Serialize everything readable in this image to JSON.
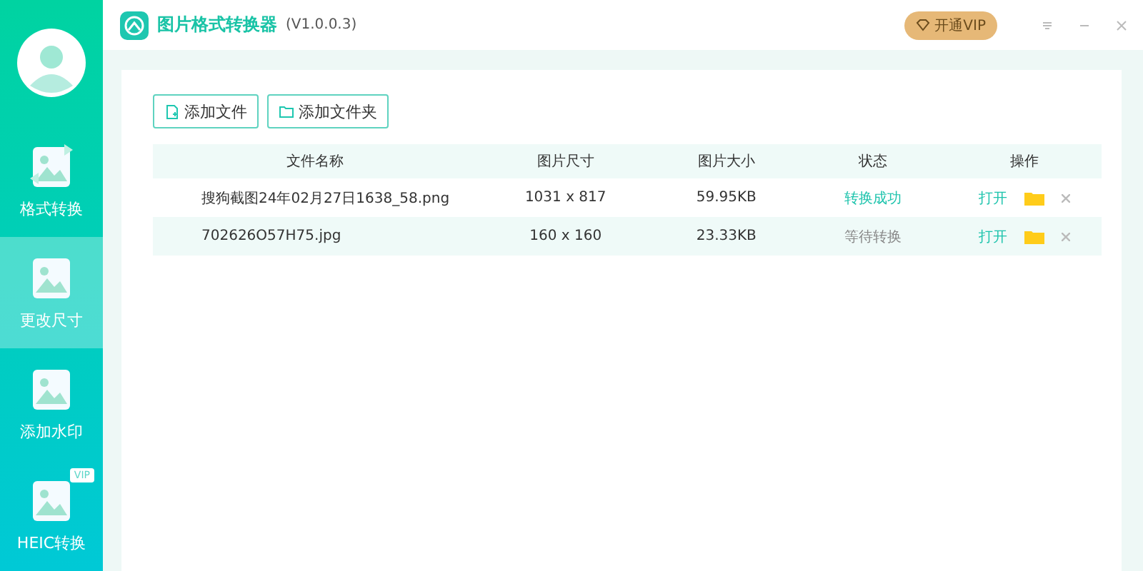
{
  "app": {
    "title": "图片格式转换器",
    "version": "(V1.0.0.3)"
  },
  "header": {
    "vip_button": "开通VIP"
  },
  "sidebar": {
    "items": [
      {
        "label": "格式转换",
        "selected": false
      },
      {
        "label": "更改尺寸",
        "selected": true
      },
      {
        "label": "添加水印",
        "selected": false
      },
      {
        "label": "HEIC转换",
        "selected": false,
        "badge": "VIP"
      }
    ]
  },
  "toolbar": {
    "buttons": [
      "添加文件",
      "添加文件夹"
    ]
  },
  "table": {
    "columns": [
      "文件名称",
      "图片尺寸",
      "图片大小",
      "状态",
      "操作"
    ],
    "rows": [
      {
        "name": "搜狗截图24年02月27日1638_58.png",
        "dimensions": "1031 x 817",
        "size": "59.95KB",
        "status": "转换成功",
        "kind": "done",
        "open": "打开"
      },
      {
        "name": "702626O57H75.jpg",
        "dimensions": "160 x 160",
        "size": "23.33KB",
        "status": "等待转换",
        "kind": "waiting",
        "open": "打开"
      }
    ]
  }
}
